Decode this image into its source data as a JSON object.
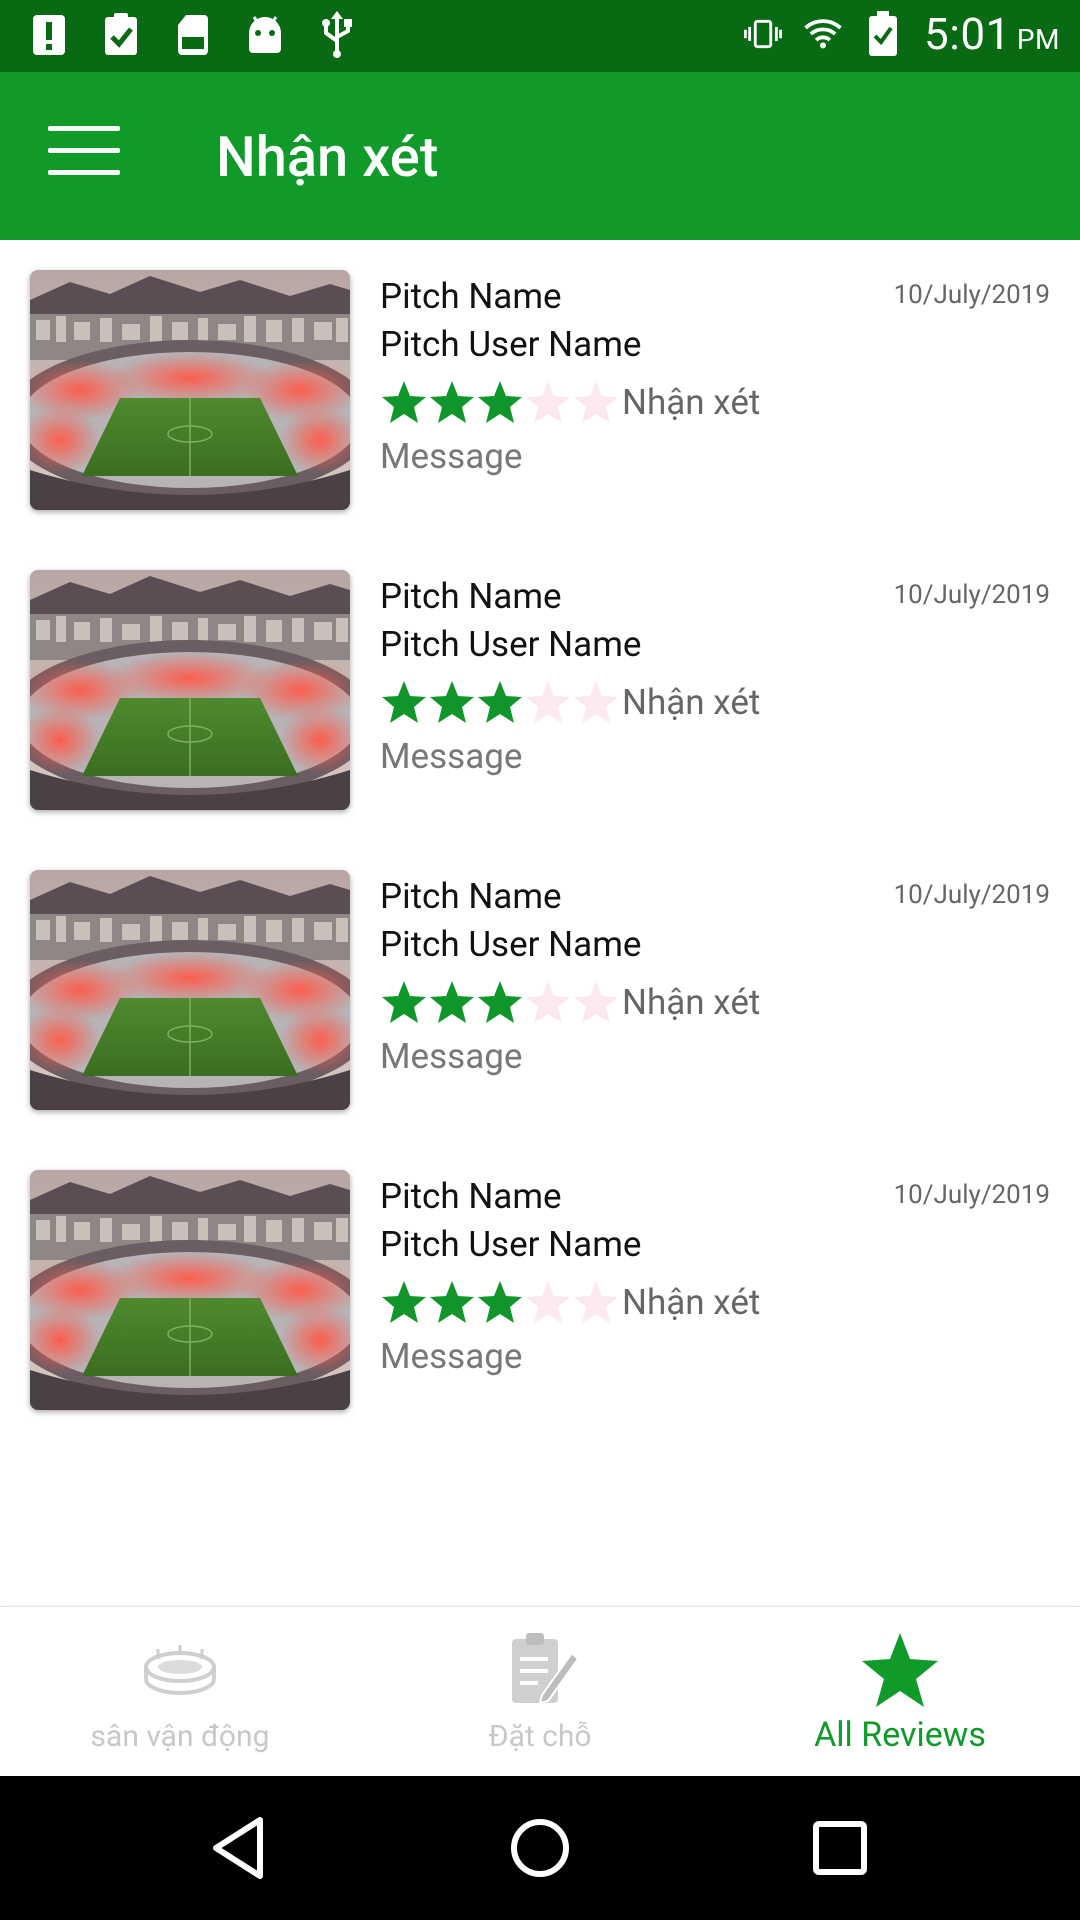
{
  "status_bar": {
    "time": "5:01",
    "ampm": "PM",
    "background": "#086b13"
  },
  "app_bar": {
    "title": "Nhận xét",
    "background": "#0f9a2a"
  },
  "reviews": [
    {
      "pitch_name": "Pitch Name",
      "user_name": "Pitch User Name",
      "date": "10/July/2019",
      "rating": 3,
      "max_rating": 5,
      "review_label": "Nhận xét",
      "message": "Message"
    },
    {
      "pitch_name": "Pitch Name",
      "user_name": "Pitch User Name",
      "date": "10/July/2019",
      "rating": 3,
      "max_rating": 5,
      "review_label": "Nhận xét",
      "message": "Message"
    },
    {
      "pitch_name": "Pitch Name",
      "user_name": "Pitch User Name",
      "date": "10/July/2019",
      "rating": 3,
      "max_rating": 5,
      "review_label": "Nhận xét",
      "message": "Message"
    },
    {
      "pitch_name": "Pitch Name",
      "user_name": "Pitch User Name",
      "date": "10/July/2019",
      "rating": 3,
      "max_rating": 5,
      "review_label": "Nhận xét",
      "message": "Message"
    }
  ],
  "bottom_nav": {
    "tabs": [
      {
        "label": "sân vận động",
        "icon": "stadium-icon",
        "active": false
      },
      {
        "label": "Đặt chỗ",
        "icon": "booking-icon",
        "active": false
      },
      {
        "label": "All Reviews",
        "icon": "star-icon",
        "active": true
      }
    ]
  },
  "colors": {
    "accent": "#0f9a2a",
    "star_filled": "#11962b",
    "star_empty": "#fbe9ee",
    "inactive_tab": "#c8c8c8"
  }
}
